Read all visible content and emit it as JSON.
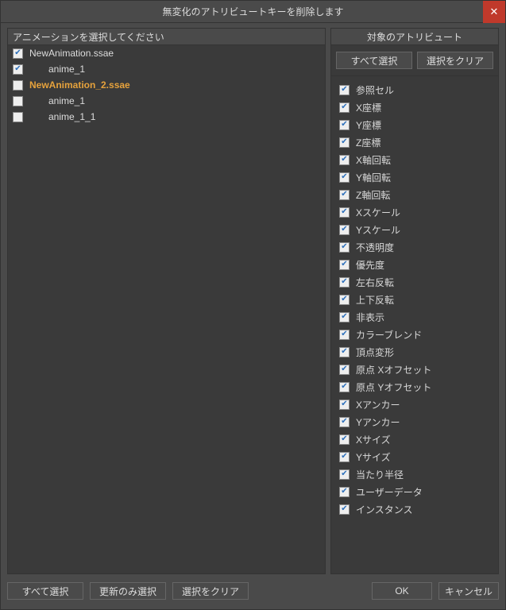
{
  "title": "無変化のアトリビュートキーを削除します",
  "left": {
    "header": "アニメーションを選択してください",
    "items": [
      {
        "label": "NewAnimation.ssae",
        "checked": true,
        "indent": 1,
        "highlight": false
      },
      {
        "label": "anime_1",
        "checked": true,
        "indent": 2,
        "highlight": false
      },
      {
        "label": "NewAnimation_2.ssae",
        "checked": false,
        "indent": 1,
        "highlight": true
      },
      {
        "label": "anime_1",
        "checked": false,
        "indent": 2,
        "highlight": false
      },
      {
        "label": "anime_1_1",
        "checked": false,
        "indent": 2,
        "highlight": false
      }
    ]
  },
  "right": {
    "header": "対象のアトリビュート",
    "select_all": "すべて選択",
    "clear_selection": "選択をクリア",
    "attributes": [
      "参照セル",
      "X座標",
      "Y座標",
      "Z座標",
      "X軸回転",
      "Y軸回転",
      "Z軸回転",
      "Xスケール",
      "Yスケール",
      "不透明度",
      "優先度",
      "左右反転",
      "上下反転",
      "非表示",
      "カラーブレンド",
      "頂点変形",
      "原点 Xオフセット",
      "原点 Yオフセット",
      "Xアンカー",
      "Yアンカー",
      "Xサイズ",
      "Yサイズ",
      "当たり半径",
      "ユーザーデータ",
      "インスタンス"
    ]
  },
  "footer": {
    "select_all": "すべて選択",
    "select_updated": "更新のみ選択",
    "clear_selection": "選択をクリア",
    "ok": "OK",
    "cancel": "キャンセル"
  }
}
